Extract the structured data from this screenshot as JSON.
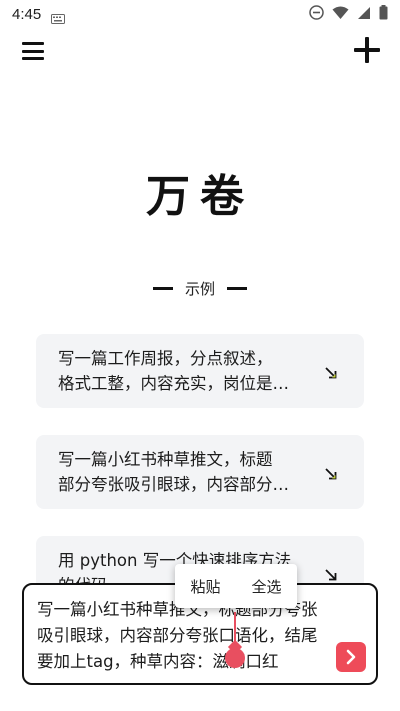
{
  "status_bar": {
    "time": "4:45",
    "icons": [
      "keyboard-icon",
      "dnd-icon",
      "wifi-icon",
      "signal-icon",
      "battery-icon"
    ]
  },
  "app_bar": {
    "menu_icon": "menu-icon",
    "add_icon": "plus-icon"
  },
  "app": {
    "title": "万卷"
  },
  "examples_section": {
    "label": "示例",
    "items": [
      {
        "line1": "写一篇工作周报，分点叙述，",
        "line2": "格式工整，内容充实，岗位是…",
        "icon": "arrow-down-right-icon"
      },
      {
        "line1": "写一篇小红书种草推文，标题",
        "line2": "部分夸张吸引眼球，内容部分…",
        "icon": "arrow-down-right-icon"
      },
      {
        "line1": "用 python 写一个快速排序方法",
        "line2": "的代码",
        "icon": "arrow-down-right-icon"
      }
    ]
  },
  "input": {
    "line1": "写一篇小红书种草推文，标题部分夸张",
    "line2": "吸引眼球，内容部分夸张口语化，结尾",
    "line3": "要加上tag，种草内容：滋润口红",
    "send_icon": "chevron-right-icon",
    "accent": "#ee4b59"
  },
  "context_menu": {
    "paste": "粘贴",
    "select_all": "全选"
  }
}
